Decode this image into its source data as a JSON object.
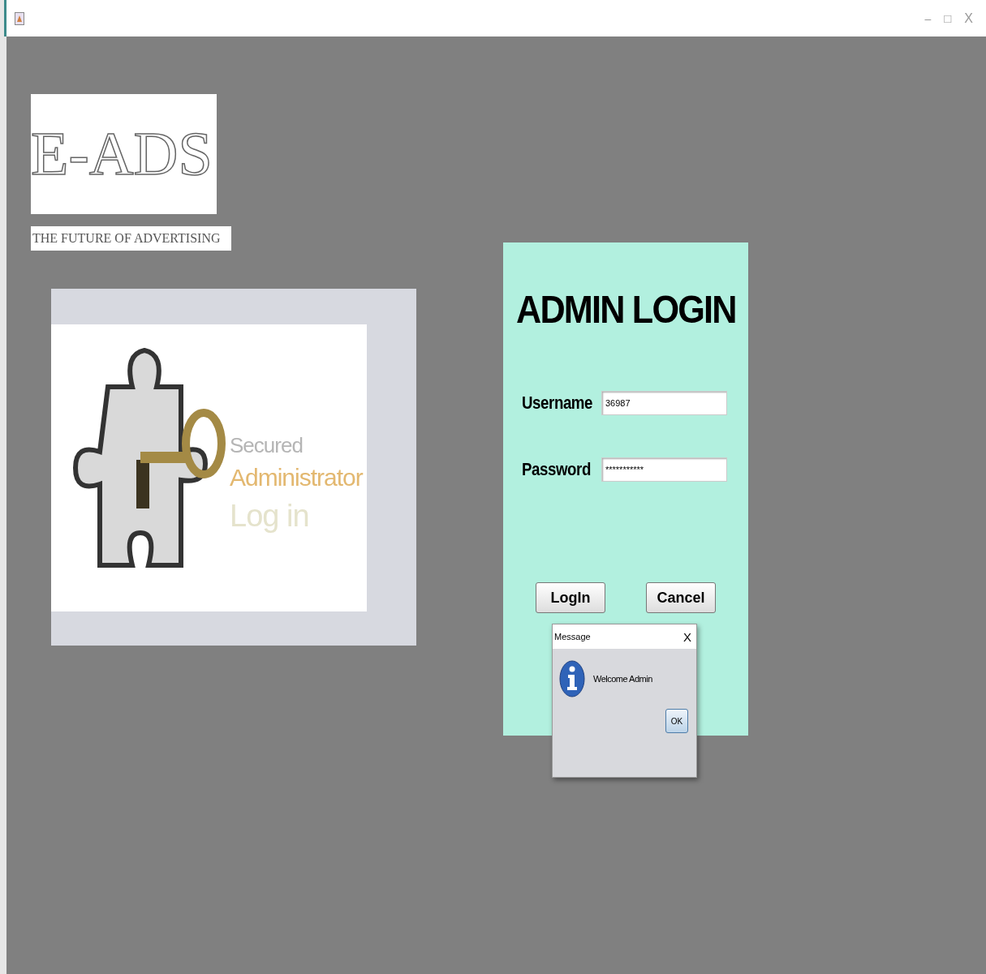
{
  "window": {
    "controls": [
      {
        "kind": "minimize",
        "label": "–"
      },
      {
        "kind": "maximize",
        "label": "□"
      },
      {
        "kind": "close",
        "label": "X"
      }
    ]
  },
  "logo": {
    "text": "E-ADS",
    "tagline": "THE FUTURE OF ADVERTISING"
  },
  "banner": {
    "lines": [
      "Secured",
      "Administrator",
      "Log in"
    ]
  },
  "login": {
    "title": "ADMIN LOGIN",
    "fields": [
      {
        "label": "Username",
        "value": "36987"
      },
      {
        "label": "Password",
        "value": "***********"
      }
    ],
    "buttons": [
      "LogIn",
      "Cancel"
    ]
  },
  "dialog": {
    "title": "Message",
    "close": "X",
    "message": "Welcome Admin",
    "button": "OK"
  }
}
